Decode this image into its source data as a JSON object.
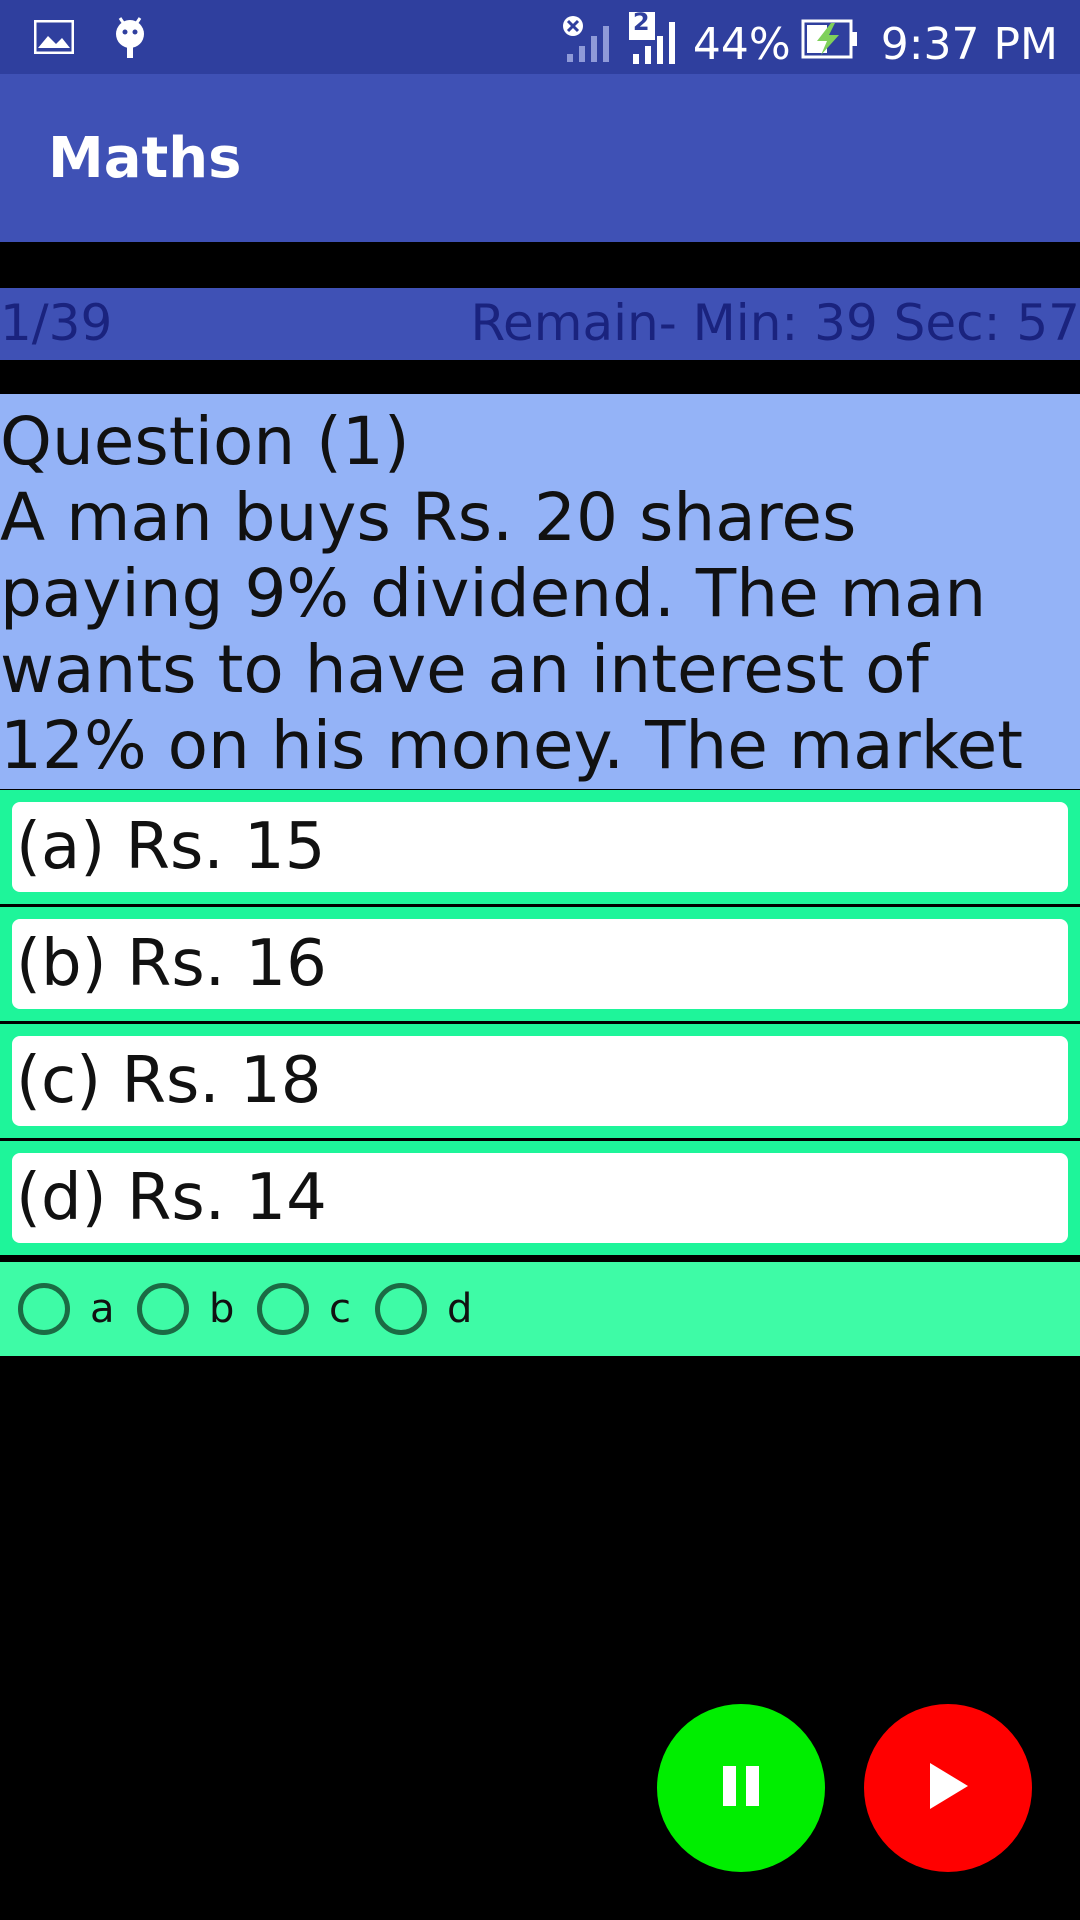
{
  "status_bar": {
    "battery": "44%",
    "time": "9:37 PM",
    "sim_label": "2",
    "icons": [
      "gallery-icon",
      "android-debug-icon",
      "signal-x-icon",
      "signal-icon",
      "battery-charging-icon"
    ]
  },
  "app_bar": {
    "title": "Maths"
  },
  "progress": {
    "count": "1/39",
    "timer": "Remain- Min: 39 Sec: 57"
  },
  "question": {
    "title": "Question (1)",
    "text": "A man buys Rs. 20 shares paying 9% dividend. The man wants to have an interest of 12% on his money. The market value of each share is:"
  },
  "options": [
    {
      "label": "(a) Rs. 15"
    },
    {
      "label": "(b) Rs. 16"
    },
    {
      "label": "(c) Rs. 18"
    },
    {
      "label": "(d) Rs. 14"
    }
  ],
  "answers": [
    {
      "label": "a",
      "selected": false
    },
    {
      "label": "b",
      "selected": false
    },
    {
      "label": "c",
      "selected": false
    },
    {
      "label": "d",
      "selected": false
    }
  ],
  "controls": {
    "pause_icon": "pause-icon",
    "play_icon": "play-icon",
    "pause_color": "#00ee00",
    "play_color": "#ff0000"
  },
  "colors": {
    "status_bar": "#2f3f9e",
    "app_bar": "#3f51b5",
    "question_bg": "#94b3f7",
    "option_border": "#1ef59a",
    "radio_row": "#3efba6"
  }
}
